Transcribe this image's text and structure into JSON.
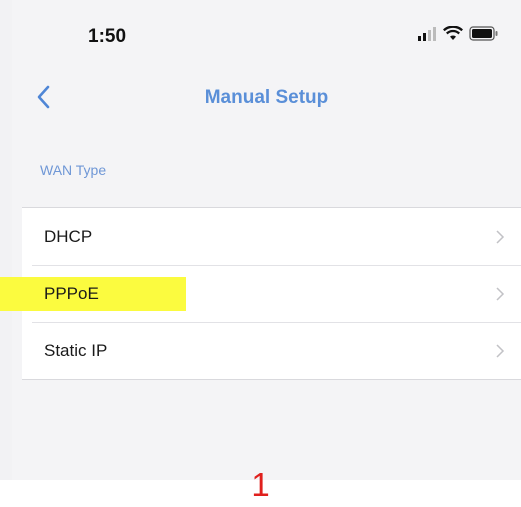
{
  "status_bar": {
    "time": "1:50",
    "icons": [
      "cellular-signal-icon",
      "wifi-icon",
      "battery-icon"
    ]
  },
  "nav": {
    "back_icon": "chevron-left-icon",
    "title": "Manual Setup"
  },
  "section": {
    "label": "WAN Type"
  },
  "wan_options": [
    {
      "label": "DHCP",
      "highlighted": false
    },
    {
      "label": "PPPoE",
      "highlighted": true
    },
    {
      "label": "Static IP",
      "highlighted": false
    }
  ],
  "annotation": {
    "step_number": "1"
  },
  "colors": {
    "accent": "#5a8fd8",
    "highlight": "#fbfb3f",
    "annotation": "#e0201d"
  }
}
